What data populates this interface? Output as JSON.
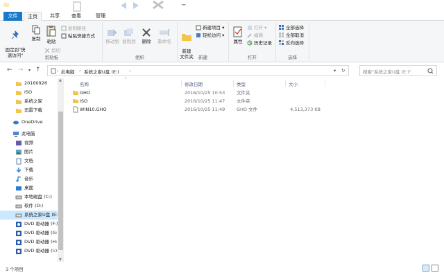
{
  "tabs": {
    "file": "文件",
    "home": "主页",
    "share": "共享",
    "view": "查看",
    "manage": "管理"
  },
  "ribbon": {
    "clipboard": {
      "label": "剪贴板",
      "pin": "固定到\"快\n速访问\"",
      "copy": "复制",
      "paste": "粘贴",
      "copy_path": "复制路径",
      "paste_shortcut": "粘贴快捷方式",
      "cut": "剪切"
    },
    "organize": {
      "label": "组织",
      "move_to": "移动到",
      "copy_to": "复制到",
      "delete": "删除",
      "rename": "重命名"
    },
    "new": {
      "label": "新建",
      "new_folder": "新建\n文件夹",
      "new_item": "新建项目",
      "easy_access": "轻松访问"
    },
    "open": {
      "label": "打开",
      "properties": "属性",
      "open": "打开",
      "edit": "编辑",
      "history": "历史记录"
    },
    "select": {
      "label": "选择",
      "select_all": "全部选择",
      "select_none": "全部取消",
      "invert": "反向选择"
    }
  },
  "address": {
    "crumbs": [
      "此电脑",
      "系统之家U盘 (E:)"
    ],
    "search_placeholder": "搜索\"系统之家U盘 (E:)\""
  },
  "nav": {
    "items": [
      {
        "label": "20160926",
        "icon": "folder-icon"
      },
      {
        "label": "ISO",
        "icon": "folder-icon"
      },
      {
        "label": "系统之家",
        "icon": "folder-icon"
      },
      {
        "label": "迅雷下载",
        "icon": "folder-icon"
      },
      {
        "label": "OneDrive",
        "icon": "cloud-icon"
      },
      {
        "label": "此电脑",
        "icon": "computer-icon"
      },
      {
        "label": "视频",
        "icon": "video-icon"
      },
      {
        "label": "图片",
        "icon": "picture-icon"
      },
      {
        "label": "文档",
        "icon": "document-icon"
      },
      {
        "label": "下载",
        "icon": "download-icon"
      },
      {
        "label": "音乐",
        "icon": "music-icon"
      },
      {
        "label": "桌面",
        "icon": "desktop-icon"
      },
      {
        "label": "本地磁盘 (C:)",
        "icon": "drive-icon"
      },
      {
        "label": "软件 (D:)",
        "icon": "drive-icon"
      },
      {
        "label": "系统之家U盘 (E:)",
        "icon": "usb-drive-icon"
      },
      {
        "label": "DVD 驱动器 (F:)",
        "icon": "dvd-icon"
      },
      {
        "label": "DVD 驱动器 (G:)",
        "icon": "dvd-icon"
      },
      {
        "label": "DVD 驱动器 (H:)",
        "icon": "dvd-icon"
      },
      {
        "label": "DVD 驱动器 (I:)",
        "icon": "dvd-icon"
      }
    ]
  },
  "files": {
    "columns": {
      "name": "名称",
      "date": "修改日期",
      "type": "类型",
      "size": "大小"
    },
    "rows": [
      {
        "name": "GHO",
        "date": "2016/10/25 10:53",
        "type": "文件夹",
        "size": "",
        "icon": "folder-icon"
      },
      {
        "name": "ISO",
        "date": "2016/10/25 11:47",
        "type": "文件夹",
        "size": "",
        "icon": "folder-icon"
      },
      {
        "name": "WIN10.GHO",
        "date": "2016/10/25 11:49",
        "type": "GHO 文件",
        "size": "4,513,373 KB",
        "icon": "file-icon"
      }
    ]
  },
  "status": {
    "count": "3 个项目"
  },
  "colors": {
    "accent": "#1979ca",
    "folder": "#f3c54d",
    "selection": "#cce8ff"
  }
}
